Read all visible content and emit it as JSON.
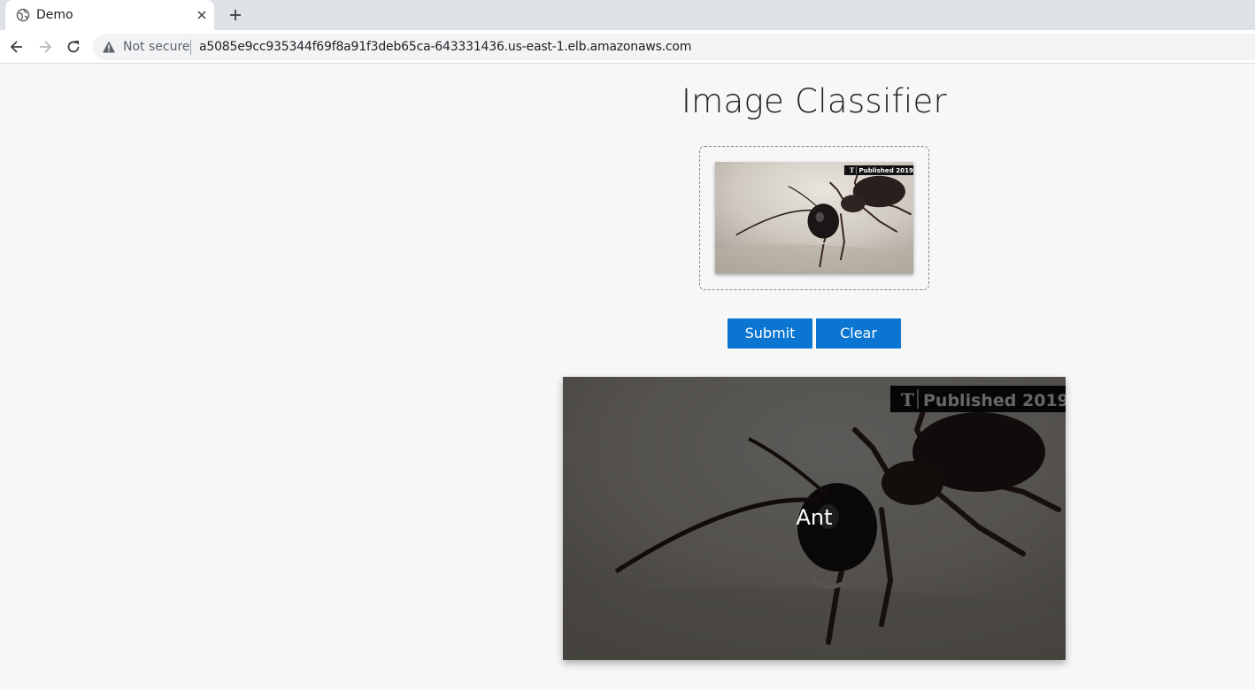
{
  "browser": {
    "tab_title": "Demo",
    "security_label": "Not secure",
    "url": "a5085e9cc935344f69f8a91f3deb65ca-643331436.us-east-1.elb.amazonaws.com"
  },
  "page": {
    "title": "Image Classifier",
    "submit_label": "Submit",
    "clear_label": "Clear",
    "prediction": "Ant"
  },
  "image": {
    "subject": "ant",
    "watermark": "Published 2019"
  },
  "colors": {
    "button": "#0b76d1",
    "page_background": "#f7f7f7"
  }
}
